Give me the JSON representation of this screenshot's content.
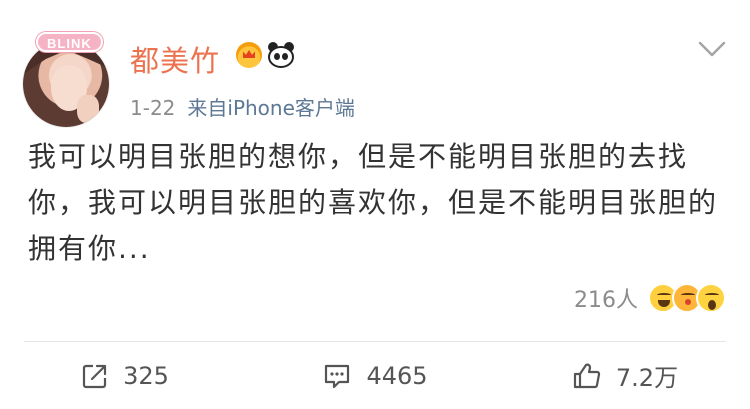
{
  "post": {
    "username": "都美竹",
    "avatar_badge": "BLINK",
    "date": "1-22",
    "source": "来自iPhone客户端",
    "content": "我可以明目张胆的想你，但是不能明目张胆的去找你，我可以明目张胆的喜欢你，但是不能明目张胆的拥有你...",
    "reactions_count": "216人",
    "icons": {
      "badge1": "crown-badge-icon",
      "badge2": "panda-badge-icon",
      "menu": "chevron-down-icon"
    }
  },
  "actions": {
    "repost": "325",
    "comment": "4465",
    "like": "7.2万"
  },
  "colors": {
    "username": "#eb7350",
    "source": "#5d7895",
    "muted": "#8b8b8b"
  }
}
